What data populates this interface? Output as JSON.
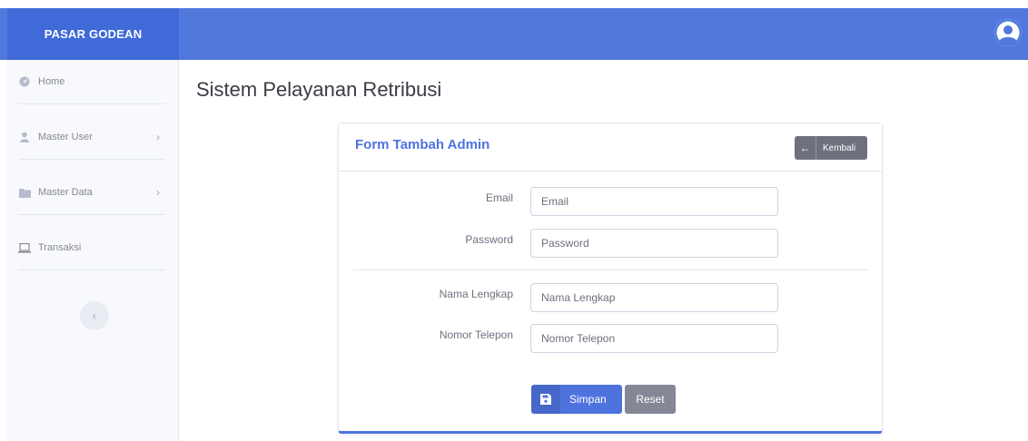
{
  "brand": "PASAR GODEAN",
  "colors": {
    "topbar": "#5078dd",
    "brand_bg": "#3f6ad8",
    "primary": "#4e73df",
    "secondary": "#858796"
  },
  "sidebar": {
    "items": [
      {
        "label": "Home",
        "icon": "dashboard-icon"
      },
      {
        "label": "Master User",
        "icon": "user-icon",
        "has_children": true
      },
      {
        "label": "Master Data",
        "icon": "folder-icon",
        "has_children": true
      },
      {
        "label": "Transaksi",
        "icon": "laptop-icon"
      }
    ],
    "toggle_glyph": "‹",
    "chevron_glyph": "›"
  },
  "page_title": "Sistem Pelayanan Retribusi",
  "form": {
    "title": "Form Tambah Admin",
    "back_label": "Kembali",
    "fields": {
      "email": {
        "label": "Email",
        "placeholder": "Email",
        "value": ""
      },
      "password": {
        "label": "Password",
        "placeholder": "Password",
        "value": ""
      },
      "nama": {
        "label": "Nama Lengkap",
        "placeholder": "Nama Lengkap",
        "value": ""
      },
      "telepon": {
        "label": "Nomor Telepon",
        "placeholder": "Nomor Telepon",
        "value": ""
      }
    },
    "save_label": "Simpan",
    "reset_label": "Reset"
  }
}
